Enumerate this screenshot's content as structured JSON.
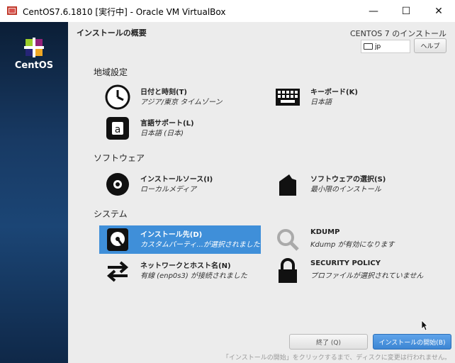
{
  "window": {
    "title": "CentOS7.6.1810 [実行中] - Oracle VM VirtualBox",
    "minimize": "—",
    "maximize": "☐",
    "close": "✕"
  },
  "sidebar": {
    "brand": "CentOS"
  },
  "header": {
    "title": "インストールの概要",
    "product": "CENTOS 7 のインストール",
    "keyboard_layout": "jp",
    "help_label": "ヘルプ"
  },
  "sections": {
    "localization": "地域設定",
    "software": "ソフトウェア",
    "system": "システム"
  },
  "spokes": {
    "datetime": {
      "name": "日付と時刻(T)",
      "status": "アジア/東京 タイムゾーン"
    },
    "keyboard": {
      "name": "キーボード(K)",
      "status": "日本語"
    },
    "language": {
      "name": "言語サポート(L)",
      "status": "日本語 (日本)"
    },
    "source": {
      "name": "インストールソース(I)",
      "status": "ローカルメディア"
    },
    "software": {
      "name": "ソフトウェアの選択(S)",
      "status": "最小限のインストール"
    },
    "destination": {
      "name": "インストール先(D)",
      "status": "カスタムパーティ...が選択されました"
    },
    "kdump": {
      "name": "KDUMP",
      "status": "Kdump が有効になります"
    },
    "network": {
      "name": "ネットワークとホスト名(N)",
      "status": "有線 (enp0s3) が接続されました"
    },
    "security": {
      "name": "SECURITY POLICY",
      "status": "プロファイルが選択されていません"
    }
  },
  "buttons": {
    "quit": "終了 (Q)",
    "begin": "インストールの開始(B)"
  },
  "footnote": "「インストールの開始」をクリックするまで、ディスクに変更は行われません。",
  "colors": {
    "selected": "#3f8fd9",
    "sidebar": "#183a64"
  }
}
